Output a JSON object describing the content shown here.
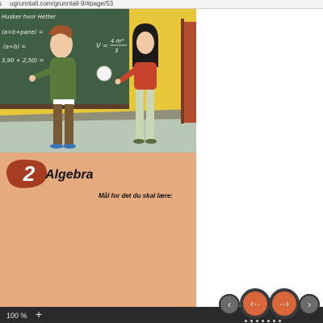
{
  "browser": {
    "url_prefix_cut": "s",
    "url": "ugrunntall.com/grunntall-9/#page/53"
  },
  "chapter": {
    "number": "2",
    "title": "Algebra",
    "goals_heading": "Mål for det du skal lære:"
  },
  "board": {
    "line1": "Husker hvor Hetter",
    "line2": "(a+b+pane) =",
    "line3": "(a+b) =",
    "line4": "3,90 + 2,50) =",
    "formula_v": "V =",
    "formula_num": "4 πr³",
    "formula_den": "3"
  },
  "viewer": {
    "zoom": "100 %",
    "zoom_plus": "+",
    "prev_small_icon": "‹",
    "prev_icon": "‹··",
    "next_icon": "··›",
    "next_small_icon": "›"
  }
}
